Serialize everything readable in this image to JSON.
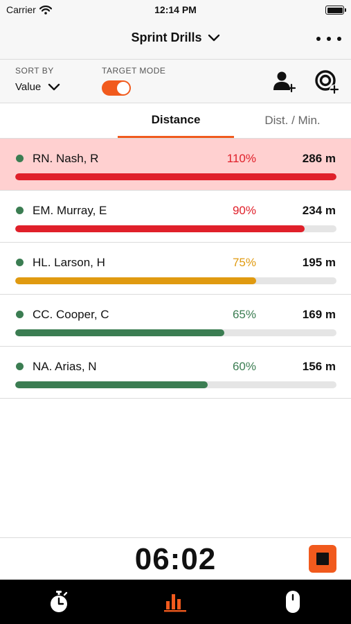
{
  "status_bar": {
    "carrier": "Carrier",
    "time": "12:14 PM"
  },
  "nav": {
    "title": "Sprint Drills",
    "title_icon": "chevron-down-icon",
    "menu_icon": "ellipsis-icon"
  },
  "controls": {
    "sort_label": "SORT BY",
    "sort_value": "Value",
    "target_label": "TARGET MODE",
    "target_mode_on": true,
    "add_user_icon": "add-user-icon",
    "add_target_icon": "add-target-icon"
  },
  "tabs": [
    {
      "label": "Distance",
      "active": true
    },
    {
      "label": "Dist. / Min.",
      "active": false
    }
  ],
  "colors": {
    "accent": "#f15a1d",
    "over": "#e0202a",
    "mid": "#e09a10",
    "ok": "#3b7d52",
    "highlight_row": "#ffd0d0"
  },
  "athletes": [
    {
      "name": "RN. Nash, R",
      "percent": "110%",
      "value": "286 m",
      "progress": 1.0,
      "status": "over",
      "highlighted": true
    },
    {
      "name": "EM. Murray, E",
      "percent": "90%",
      "value": "234 m",
      "progress": 0.9,
      "status": "over",
      "highlighted": false
    },
    {
      "name": "HL. Larson, H",
      "percent": "75%",
      "value": "195 m",
      "progress": 0.75,
      "status": "mid",
      "highlighted": false
    },
    {
      "name": "CC. Cooper, C",
      "percent": "65%",
      "value": "169 m",
      "progress": 0.65,
      "status": "ok",
      "highlighted": false
    },
    {
      "name": "NA. Arias, N",
      "percent": "60%",
      "value": "156 m",
      "progress": 0.6,
      "status": "ok",
      "highlighted": false
    }
  ],
  "timer": {
    "value": "06:02",
    "stop_icon": "stop-icon"
  },
  "tab_bar": [
    {
      "icon": "stopwatch-icon",
      "active": false
    },
    {
      "icon": "bar-chart-icon",
      "active": true
    },
    {
      "icon": "tracker-device-icon",
      "active": false
    }
  ]
}
